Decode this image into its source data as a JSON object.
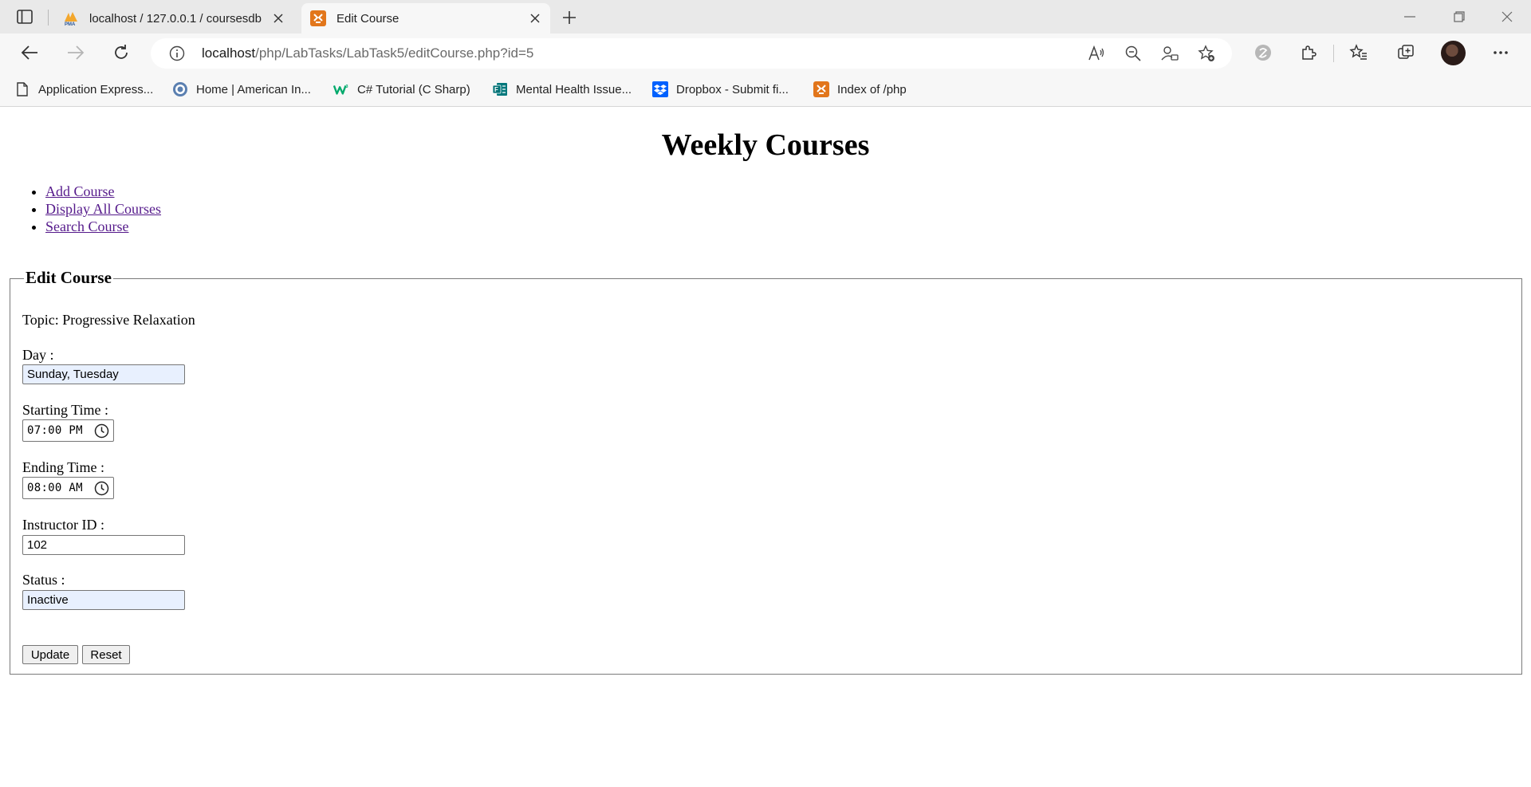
{
  "browser": {
    "tabs": [
      {
        "title": "localhost / 127.0.0.1 / coursesdb",
        "icon": "phpmyadmin-icon"
      },
      {
        "title": "Edit Course",
        "icon": "xampp-icon"
      }
    ],
    "url": {
      "host": "localhost",
      "path": "/php/LabTasks/LabTask5/editCourse.php?id=5"
    },
    "bookmarks": [
      {
        "label": "Application Express...",
        "icon": "document-icon"
      },
      {
        "label": "Home | American In...",
        "icon": "globe-icon"
      },
      {
        "label": "C# Tutorial (C Sharp)",
        "icon": "w3schools-icon"
      },
      {
        "label": "Mental Health Issue...",
        "icon": "forms-icon"
      },
      {
        "label": "Dropbox - Submit fi...",
        "icon": "dropbox-icon"
      },
      {
        "label": "Index of /php",
        "icon": "xampp-icon"
      }
    ]
  },
  "page": {
    "heading": "Weekly Courses",
    "nav": [
      {
        "label": "Add Course"
      },
      {
        "label": "Display All Courses"
      },
      {
        "label": "Search Course"
      }
    ],
    "form": {
      "legend": "Edit Course",
      "topic": "Topic: Progressive Relaxation",
      "day_label": "Day :",
      "day_value": "Sunday, Tuesday",
      "start_label": "Starting Time :",
      "start_value": "07:00 PM",
      "end_label": "Ending Time :",
      "end_value": "08:00 AM",
      "instructor_label": "Instructor ID :",
      "instructor_value": "102",
      "status_label": "Status :",
      "status_value": "Inactive",
      "update_label": "Update",
      "reset_label": "Reset"
    }
  },
  "colors": {
    "visited_link": "#551a8b",
    "autofill_bg": "#e8f0fe",
    "xampp_orange": "#e2761b"
  }
}
